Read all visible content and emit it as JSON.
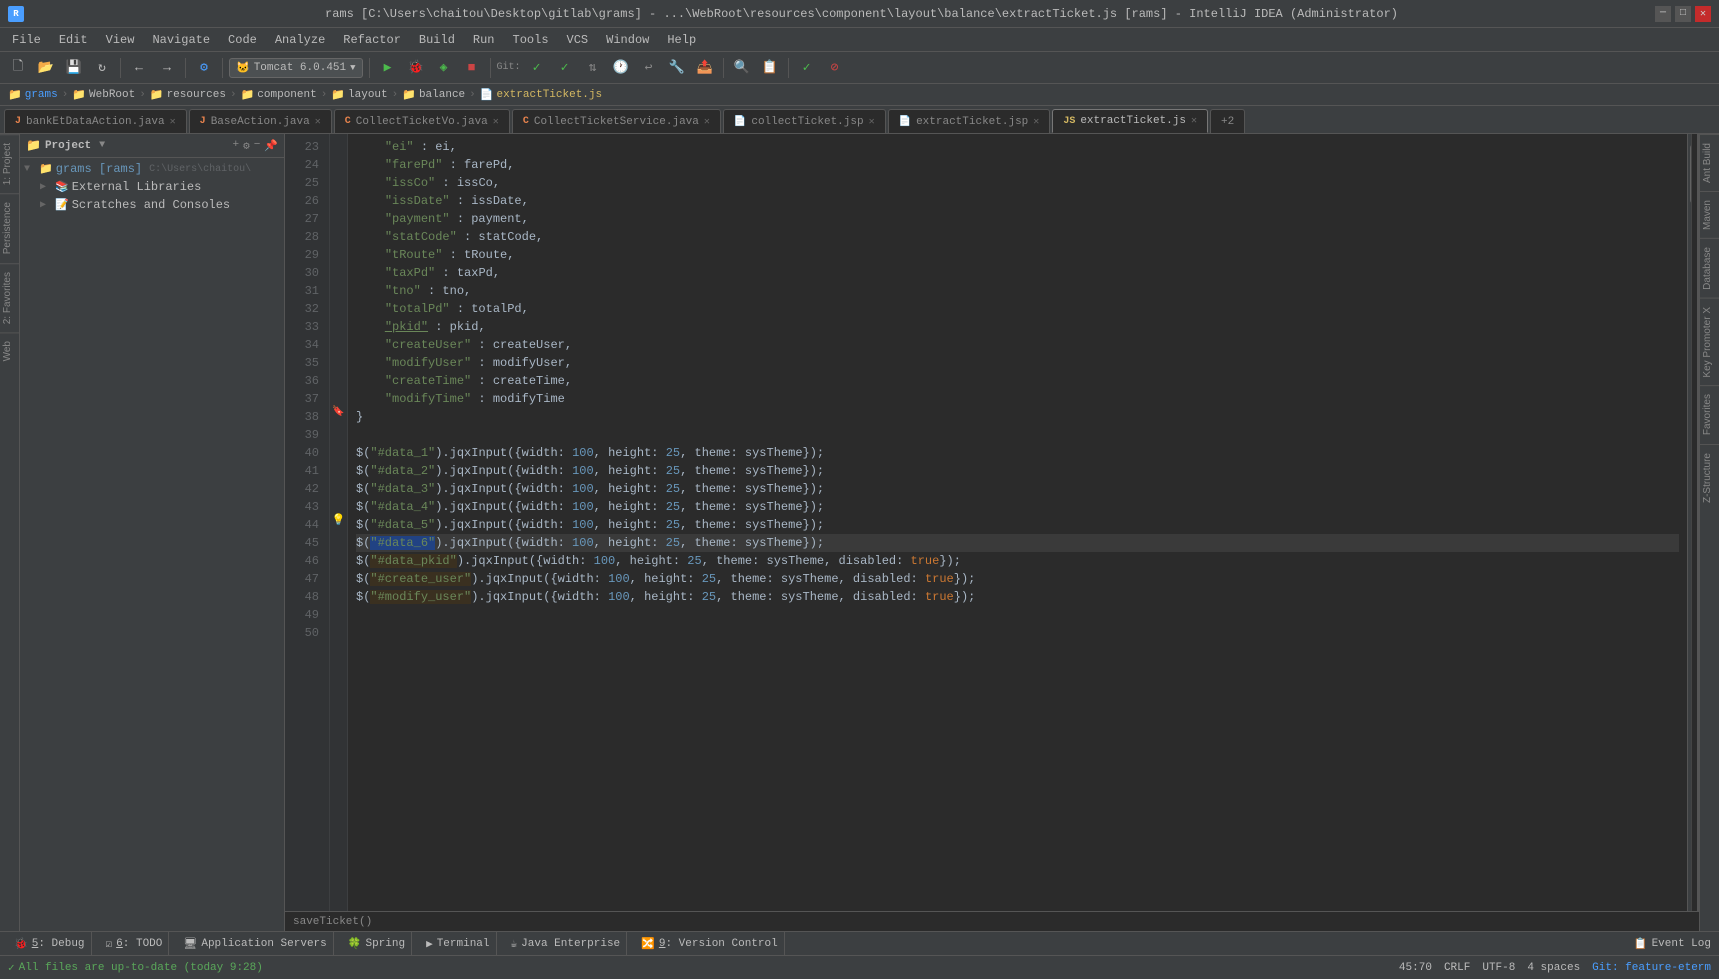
{
  "titleBar": {
    "text": "rams [C:\\Users\\chaitou\\Desktop\\gitlab\\grams] - ...\\WebRoot\\resources\\component\\layout\\balance\\extractTicket.js [rams] - IntelliJ IDEA (Administrator)"
  },
  "menuBar": {
    "items": [
      "File",
      "Edit",
      "View",
      "Navigate",
      "Code",
      "Analyze",
      "Refactor",
      "Build",
      "Run",
      "Tools",
      "VCS",
      "Window",
      "Help"
    ]
  },
  "toolbar": {
    "tomcat": "Tomcat 6.0.451"
  },
  "breadcrumb": {
    "items": [
      "grams",
      "WebRoot",
      "resources",
      "component",
      "layout",
      "balance",
      "extractTicket.js"
    ]
  },
  "tabs": [
    {
      "label": "bankEtDataAction.java",
      "type": "java",
      "active": false,
      "closable": true
    },
    {
      "label": "BaseAction.java",
      "type": "java",
      "active": false,
      "closable": true
    },
    {
      "label": "CollectTicketVo.java",
      "type": "java",
      "active": false,
      "closable": true
    },
    {
      "label": "CollectTicketService.java",
      "type": "java",
      "active": false,
      "closable": true
    },
    {
      "label": "collectTicket.jsp",
      "type": "jsp",
      "active": false,
      "closable": true
    },
    {
      "label": "extractTicket.jsp",
      "type": "jsp",
      "active": false,
      "closable": true
    },
    {
      "label": "extractTicket.js",
      "type": "js",
      "active": true,
      "closable": true
    },
    {
      "label": "+2",
      "type": "more",
      "active": false,
      "closable": false
    }
  ],
  "projectPanel": {
    "title": "Project",
    "tree": [
      {
        "label": "grams [rams] C:\\Users\\chaitou\\",
        "type": "root",
        "indent": 0,
        "expanded": true
      },
      {
        "label": "External Libraries",
        "type": "folder",
        "indent": 1,
        "expanded": false
      },
      {
        "label": "Scratches and Consoles",
        "type": "folder",
        "indent": 1,
        "expanded": false
      }
    ]
  },
  "codeLines": [
    {
      "num": 23,
      "content": "    \"ei\" : ei,",
      "highlight": false,
      "gutter": ""
    },
    {
      "num": 24,
      "content": "    \"farePd\" : farePd,",
      "highlight": false,
      "gutter": ""
    },
    {
      "num": 25,
      "content": "    \"issCo\" : issCo,",
      "highlight": false,
      "gutter": ""
    },
    {
      "num": 26,
      "content": "    \"issDate\" : issDate,",
      "highlight": false,
      "gutter": ""
    },
    {
      "num": 27,
      "content": "    \"payment\" : payment,",
      "highlight": false,
      "gutter": ""
    },
    {
      "num": 28,
      "content": "    \"statCode\" : statCode,",
      "highlight": false,
      "gutter": ""
    },
    {
      "num": 29,
      "content": "    \"tRoute\" : tRoute,",
      "highlight": false,
      "gutter": ""
    },
    {
      "num": 30,
      "content": "    \"taxPd\" : taxPd,",
      "highlight": false,
      "gutter": ""
    },
    {
      "num": 31,
      "content": "    \"tno\" : tno,",
      "highlight": false,
      "gutter": ""
    },
    {
      "num": 32,
      "content": "    \"totalPd\" : totalPd,",
      "highlight": false,
      "gutter": ""
    },
    {
      "num": 33,
      "content": "    \"pkid\" : pkid,",
      "highlight": false,
      "gutter": ""
    },
    {
      "num": 34,
      "content": "    \"createUser\" : createUser,",
      "highlight": false,
      "gutter": ""
    },
    {
      "num": 35,
      "content": "    \"modifyUser\" : modifyUser,",
      "highlight": false,
      "gutter": ""
    },
    {
      "num": 36,
      "content": "    \"createTime\" : createTime,",
      "highlight": false,
      "gutter": ""
    },
    {
      "num": 37,
      "content": "    \"modifyTime\" : modifyTime",
      "highlight": false,
      "gutter": ""
    },
    {
      "num": 38,
      "content": "}",
      "highlight": false,
      "gutter": "bookmark"
    },
    {
      "num": 39,
      "content": "",
      "highlight": false,
      "gutter": ""
    },
    {
      "num": 40,
      "content": "$(\"#data_1\").jqxInput({width: 100, height: 25, theme: sysTheme});",
      "highlight": false,
      "gutter": ""
    },
    {
      "num": 41,
      "content": "$(\"#data_2\").jqxInput({width: 100, height: 25, theme: sysTheme});",
      "highlight": false,
      "gutter": ""
    },
    {
      "num": 42,
      "content": "$(\"#data_3\").jqxInput({width: 100, height: 25, theme: sysTheme});",
      "highlight": false,
      "gutter": ""
    },
    {
      "num": 43,
      "content": "$(\"#data_4\").jqxInput({width: 100, height: 25, theme: sysTheme});",
      "highlight": false,
      "gutter": ""
    },
    {
      "num": 44,
      "content": "$(\"#data_5\").jqxInput({width: 100, height: 25, theme: sysTheme});",
      "highlight": false,
      "gutter": "lightbulb"
    },
    {
      "num": 45,
      "content": "$(\"#data_6\").jqxInput({width: 100, height: 25, theme: sysTheme});",
      "highlight": true,
      "gutter": ""
    },
    {
      "num": 46,
      "content": "$(\"#data_pkid\").jqxInput({width: 100, height: 25, theme: sysTheme, disabled: true});",
      "highlight": false,
      "gutter": ""
    },
    {
      "num": 47,
      "content": "$(\"#create_user\").jqxInput({width: 100, height: 25, theme: sysTheme, disabled: true});",
      "highlight": false,
      "gutter": ""
    },
    {
      "num": 48,
      "content": "$(\"#modify_user\").jqxInput({width: 100, height: 25, theme: sysTheme, disabled: true});",
      "highlight": false,
      "gutter": ""
    },
    {
      "num": 49,
      "content": "",
      "highlight": false,
      "gutter": ""
    },
    {
      "num": 50,
      "content": "",
      "highlight": false,
      "gutter": ""
    }
  ],
  "rightSidebar": {
    "labels": [
      "Ant Build",
      "Maven",
      "Database",
      "Key Promoter X",
      "Favorites"
    ]
  },
  "leftSidebar": {
    "labels": [
      "1: Project",
      "Persistence",
      "2: Favorites",
      "Web"
    ]
  },
  "statusBar": {
    "message": "All files are up-to-date (today 9:28)",
    "position": "45:70",
    "lineEnding": "CRLF",
    "encoding": "UTF-8",
    "indent": "4 spaces",
    "branch": "Git: feature-eterm"
  },
  "bottomBar": {
    "tabs": [
      {
        "num": "5",
        "label": "Debug"
      },
      {
        "num": "6",
        "label": "TODO"
      },
      {
        "label": "Application Servers"
      },
      {
        "label": "Spring"
      },
      {
        "label": "Terminal"
      },
      {
        "label": "Java Enterprise"
      },
      {
        "num": "9",
        "label": "Version Control"
      }
    ],
    "right": "Event Log"
  },
  "functionHint": "saveTicket()"
}
